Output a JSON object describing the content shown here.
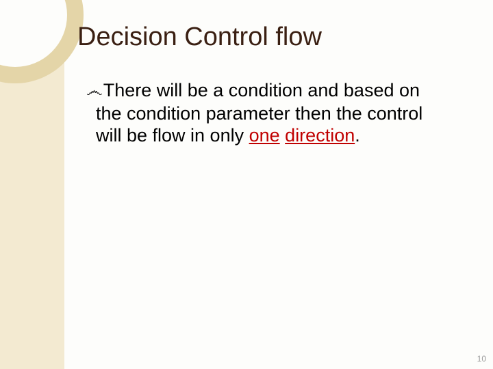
{
  "slide": {
    "title": "Decision Control flow",
    "bullet_glyph": "෴",
    "body_pre": "There will be a condition and based on the condition parameter then the control will be flow in only ",
    "body_kw1": "one",
    "body_mid": " ",
    "body_kw2": "direction",
    "body_post": ".",
    "page_number": "10"
  }
}
